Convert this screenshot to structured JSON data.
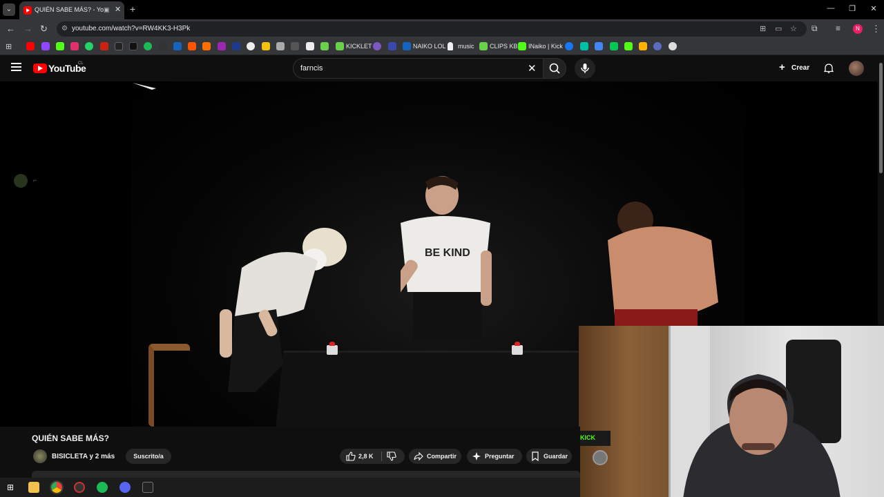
{
  "browser": {
    "tab_title": "QUIÉN SABE MÁS? - YouTube",
    "url": "youtube.com/watch?v=RW4KK3-H3Pk",
    "profile_initial": "N"
  },
  "bookmarks": {
    "labeled": [
      {
        "label": "KICKLET"
      },
      {
        "label": "NAIKO LOL"
      },
      {
        "label": "music"
      },
      {
        "label": "CLIPS KB"
      },
      {
        "label": "INaiko | Kick"
      }
    ]
  },
  "youtube": {
    "logo_text": "YouTube",
    "country_code": "CL",
    "search_value": "farncis",
    "create_label": "Crear"
  },
  "video": {
    "title": "QUIÉN SABE MÁS?",
    "channel": "BISICLETA y 2 más",
    "subscribed_label": "Suscrito/a",
    "likes": "2,8 K",
    "share_label": "Compartir",
    "ask_label": "Preguntar",
    "save_label": "Guardar"
  },
  "webcam": {
    "overlay_text": "KICK"
  },
  "colors": {
    "yt_red": "#ff0000",
    "kick_green": "#53fc18",
    "bg": "#0f0f0f"
  }
}
